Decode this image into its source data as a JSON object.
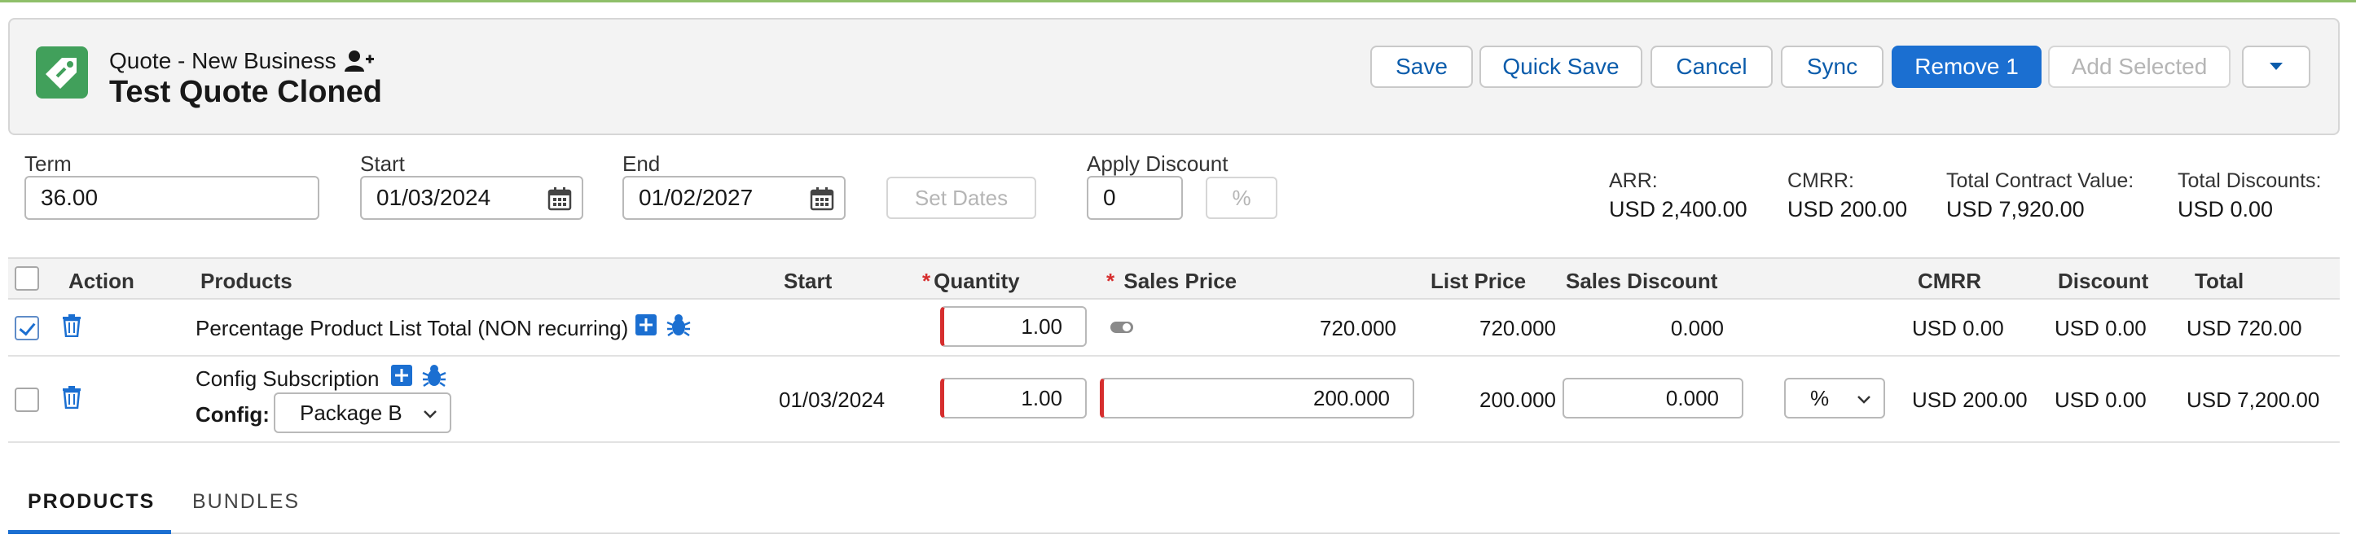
{
  "header": {
    "subtitle": "Quote - New Business",
    "title": "Test Quote Cloned",
    "buttons": {
      "save": "Save",
      "quick_save": "Quick Save",
      "cancel": "Cancel",
      "sync": "Sync",
      "remove": "Remove 1",
      "add_selected": "Add Selected"
    }
  },
  "fields": {
    "term_label": "Term",
    "term_value": "36.00",
    "start_label": "Start",
    "start_value": "01/03/2024",
    "end_label": "End",
    "end_value": "01/02/2027",
    "set_dates": "Set Dates",
    "apply_discount_label": "Apply Discount",
    "apply_discount_value": "0",
    "percent_symbol": "%"
  },
  "metrics": [
    {
      "label": "ARR:",
      "value": "USD 2,400.00"
    },
    {
      "label": "CMRR:",
      "value": "USD 200.00"
    },
    {
      "label": "Total Contract Value:",
      "value": "USD 7,920.00"
    },
    {
      "label": "Total Discounts:",
      "value": "USD 0.00"
    }
  ],
  "table": {
    "headers": {
      "action": "Action",
      "products": "Products",
      "start": "Start",
      "quantity": "Quantity",
      "sales_price": "Sales Price",
      "list_price": "List Price",
      "sales_discount": "Sales Discount",
      "cmrr": "CMRR",
      "discount": "Discount",
      "total": "Total",
      "required_marker": "*"
    },
    "rows": [
      {
        "product": "Percentage Product List Total (NON recurring)",
        "start": "",
        "quantity": "1.00",
        "sales_price": "720.000",
        "list_price": "720.000",
        "sales_discount": "0.000",
        "cmrr": "USD 0.00",
        "discount": "USD 0.00",
        "total": "USD 720.00",
        "selected": true
      },
      {
        "product": "Config Subscription",
        "config_label": "Config:",
        "config_value": "Package B",
        "start": "01/03/2024",
        "quantity": "1.00",
        "sales_price": "200.000",
        "list_price": "200.000",
        "sales_discount": "0.000",
        "discount_type": "%",
        "cmrr": "USD 200.00",
        "discount": "USD 0.00",
        "total": "USD 7,200.00",
        "selected": false
      }
    ]
  },
  "tabs": [
    {
      "label": "PRODUCTS",
      "active": true
    },
    {
      "label": "BUNDLES",
      "active": false
    }
  ],
  "colors": {
    "brand_blue": "#1b6fd1",
    "app_icon_green": "#41a05b",
    "required_red": "#d62e2e"
  },
  "icons": [
    "tag-icon",
    "add-user-icon",
    "calendar-icon",
    "trash-icon",
    "plus-square-icon",
    "bug-icon",
    "toggle-icon",
    "chevron-down-icon"
  ]
}
